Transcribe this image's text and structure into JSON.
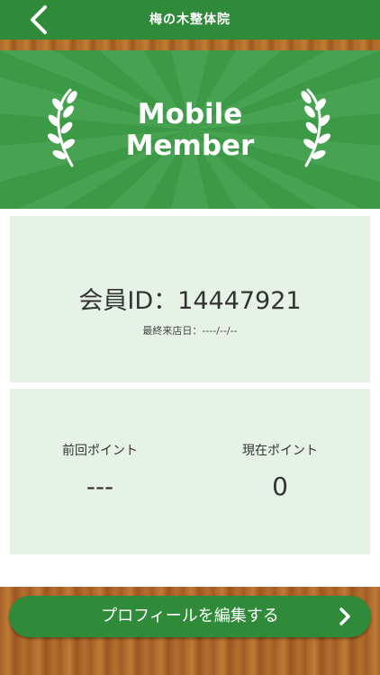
{
  "header": {
    "title": "梅の木整体院",
    "back_icon": "chevron-left-icon"
  },
  "banner": {
    "line1": "Mobile",
    "line2": "Member",
    "left_icon": "laurel-left-icon",
    "right_icon": "laurel-right-icon",
    "colors": {
      "base": "#3c9a46",
      "ray": "#4aa553"
    }
  },
  "member": {
    "id_text": "会員ID：14447921",
    "last_visit": "最終来店日：----/--/--"
  },
  "points": {
    "previous_label": "前回ポイント",
    "previous_value": "---",
    "current_label": "現在ポイント",
    "current_value": "0"
  },
  "footer": {
    "edit_button_label": "プロフィールを編集する",
    "edit_icon": "chevron-right-icon"
  },
  "colors": {
    "accent": "#2f8a3a",
    "card_bg": "#e7f2e7",
    "wood": "#b06a28"
  }
}
